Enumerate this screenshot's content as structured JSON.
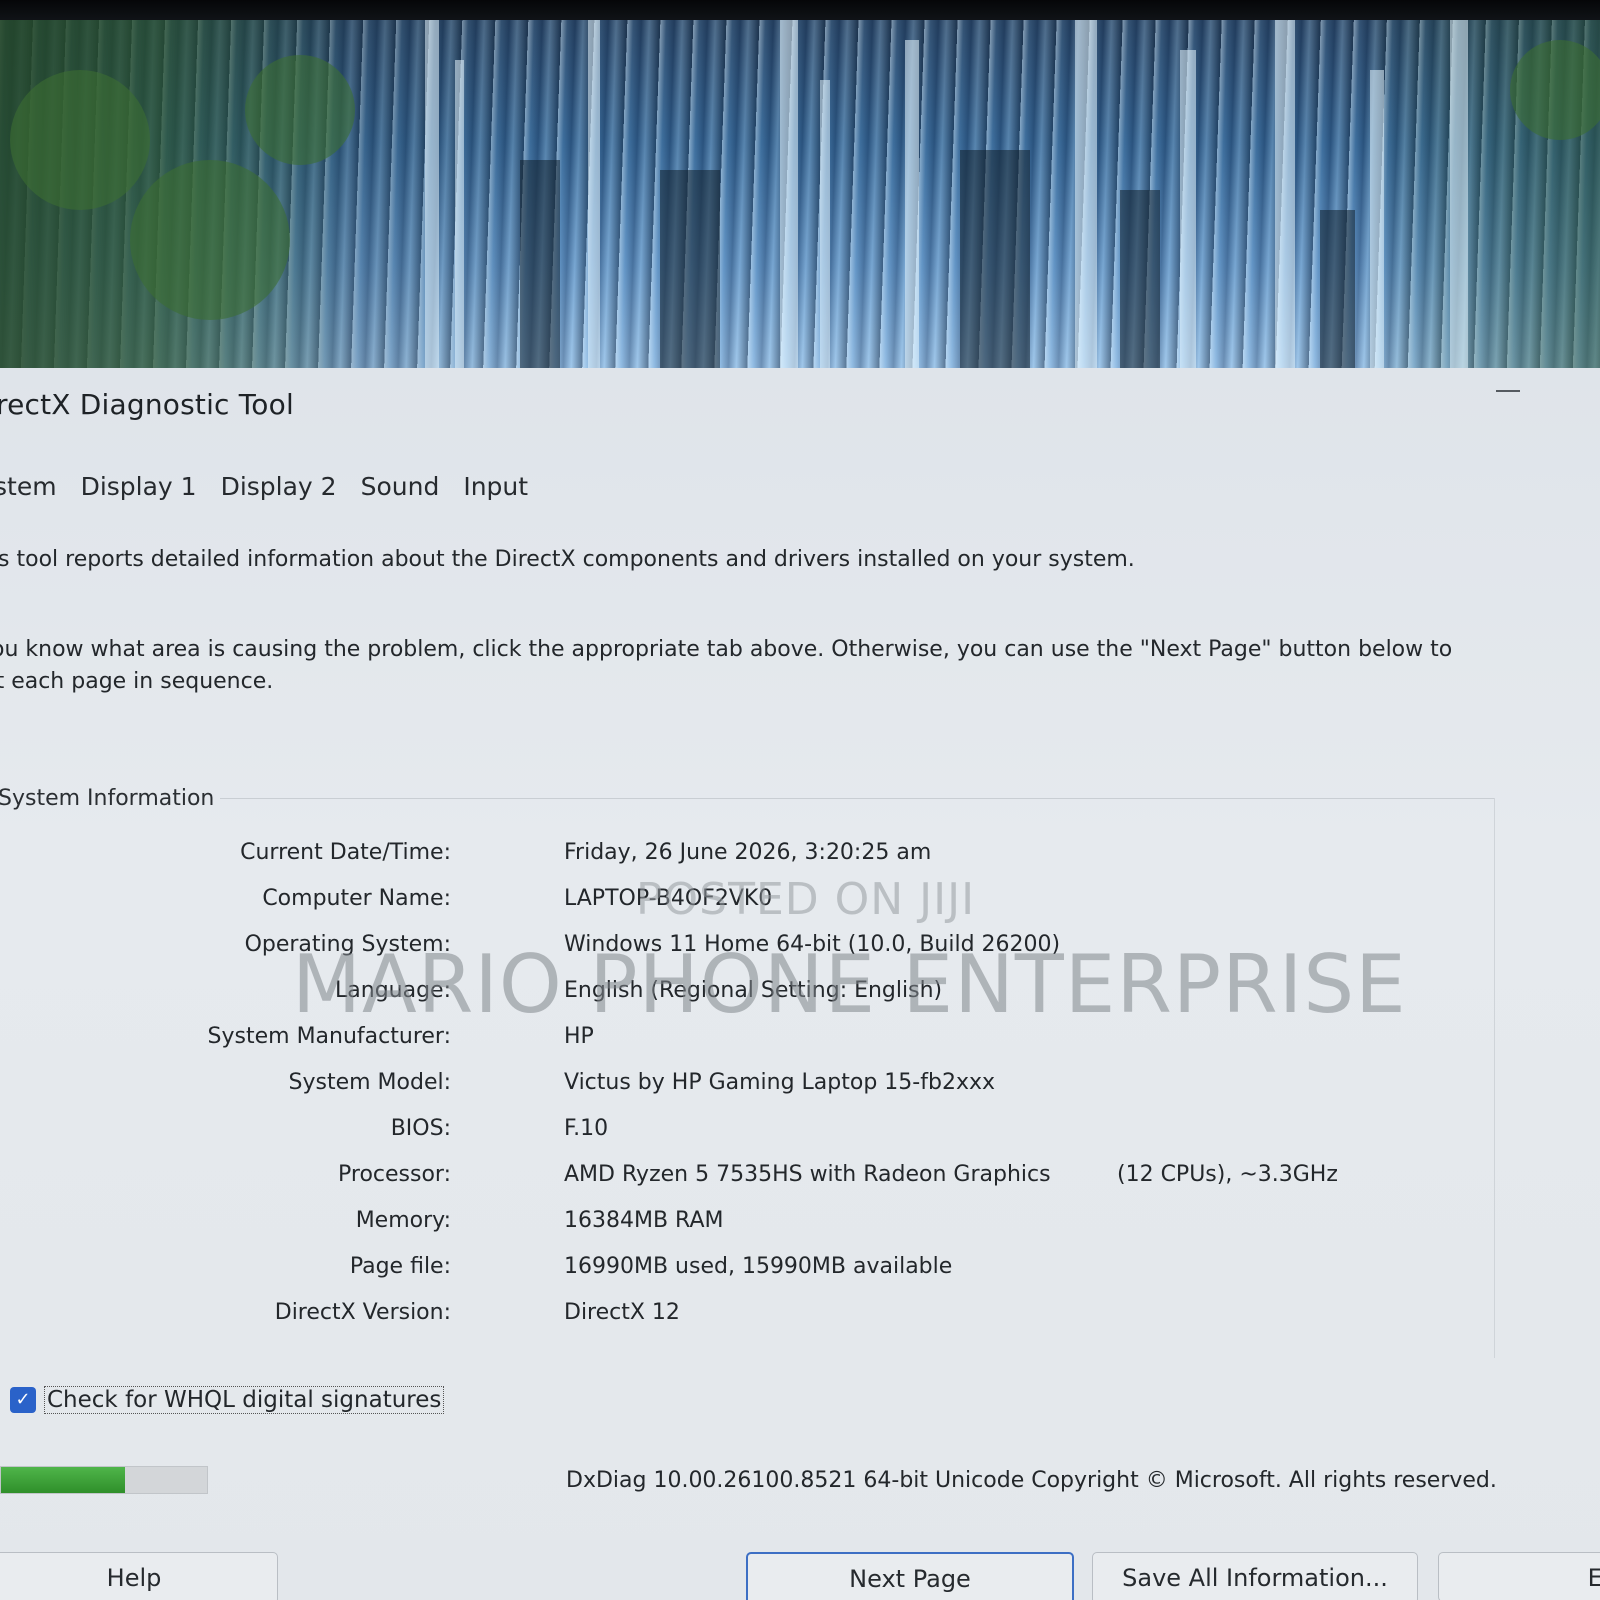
{
  "window": {
    "title": "irectX Diagnostic Tool",
    "minimize_glyph": "—"
  },
  "tabs": [
    {
      "label": "stem"
    },
    {
      "label": "Display 1"
    },
    {
      "label": "Display 2"
    },
    {
      "label": "Sound"
    },
    {
      "label": "Input"
    }
  ],
  "intro": {
    "line1": "his tool reports detailed information about the DirectX components and drivers installed on your system.",
    "line2": "you know what area is causing the problem, click the appropriate tab above.  Otherwise, you can use the \"Next Page\" button below to",
    "line3": "sit each page in sequence."
  },
  "system_info": {
    "section_title": "System Information",
    "rows": [
      {
        "label": "Current Date/Time:",
        "value": "Friday, 26 June 2026, 3:20:25 am"
      },
      {
        "label": "Computer Name:",
        "value": "LAPTOP-B4OF2VK0"
      },
      {
        "label": "Operating System:",
        "value": "Windows 11 Home 64-bit (10.0, Build 26200)"
      },
      {
        "label": "Language:",
        "value": "English (Regional Setting: English)"
      },
      {
        "label": "System Manufacturer:",
        "value": "HP"
      },
      {
        "label": "System Model:",
        "value": "Victus by HP Gaming Laptop 15-fb2xxx"
      },
      {
        "label": "BIOS:",
        "value": "F.10"
      },
      {
        "label": "Processor:",
        "value": "AMD Ryzen 5 7535HS with Radeon Graphics",
        "extra": "(12 CPUs), ~3.3GHz"
      },
      {
        "label": "Memory:",
        "value": "16384MB RAM"
      },
      {
        "label": "Page file:",
        "value": "16990MB used, 15990MB available"
      },
      {
        "label": "DirectX Version:",
        "value": "DirectX 12"
      }
    ]
  },
  "whql": {
    "label": "Check for WHQL digital signatures",
    "checked": true,
    "check_glyph": "✓"
  },
  "progress": {
    "fraction": 0.6,
    "color": "#3aa035"
  },
  "footer": {
    "copyright": "DxDiag 10.00.26100.8521 64-bit Unicode  Copyright © Microsoft. All rights reserved."
  },
  "buttons": {
    "help": "Help",
    "next": "Next Page",
    "save": "Save All Information...",
    "exit": "Ex"
  },
  "watermark": {
    "small": "POSTED ON JIJI",
    "big": "MARIO PHONE ENTERPRISE"
  },
  "colors": {
    "accent": "#2a62c9",
    "window_bg": "#e3e7eb"
  }
}
